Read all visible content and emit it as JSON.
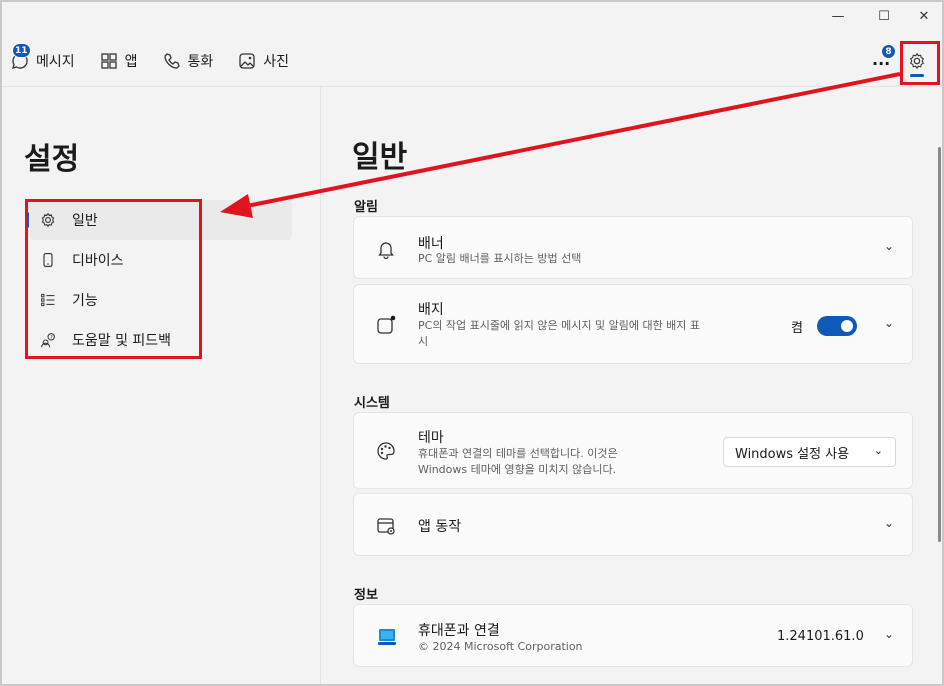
{
  "window": {
    "minimize_glyph": "—",
    "maximize_glyph": "☐",
    "close_glyph": "✕"
  },
  "topnav": {
    "items": [
      {
        "label": "메시지",
        "icon": "chat-icon",
        "badge": "11"
      },
      {
        "label": "앱",
        "icon": "apps-icon"
      },
      {
        "label": "통화",
        "icon": "phone-icon"
      },
      {
        "label": "사진",
        "icon": "photo-icon"
      }
    ],
    "more_label": "...",
    "notifications_badge": "8",
    "settings_icon": "gear-icon"
  },
  "left": {
    "title": "설정",
    "items": [
      {
        "label": "일반",
        "icon": "gear-icon",
        "selected": true
      },
      {
        "label": "디바이스",
        "icon": "phone-device-icon"
      },
      {
        "label": "기능",
        "icon": "list-icon"
      },
      {
        "label": "도움말 및 피드백",
        "icon": "people-help-icon"
      }
    ]
  },
  "right": {
    "title": "일반",
    "sections": {
      "alerts": "알림",
      "system": "시스템",
      "info": "정보"
    },
    "banner": {
      "title": "배너",
      "desc": "PC 알림 배너를 표시하는 방법 선택"
    },
    "badge": {
      "title": "배지",
      "desc_line1": "PC의 작업 표시줄에 읽지 않은 메시지 및 알림에 대한 배지 표",
      "desc_line2": "시",
      "toggle_label": "켬",
      "toggle_on": true
    },
    "theme": {
      "title": "테마",
      "desc_line1": "휴대폰과 연결의 테마를 선택합니다. 이것은",
      "desc_line2": "Windows 테마에 영향을 미치지 않습니다.",
      "select_value": "Windows 설정 사용"
    },
    "app_behavior": {
      "title": "앱 동작"
    },
    "about": {
      "title": "휴대폰과 연결",
      "desc": "© 2024 Microsoft Corporation",
      "version": "1.24101.61.0"
    }
  },
  "colors": {
    "accent": "#0f5ab8",
    "annotation_red": "#e0141e"
  }
}
